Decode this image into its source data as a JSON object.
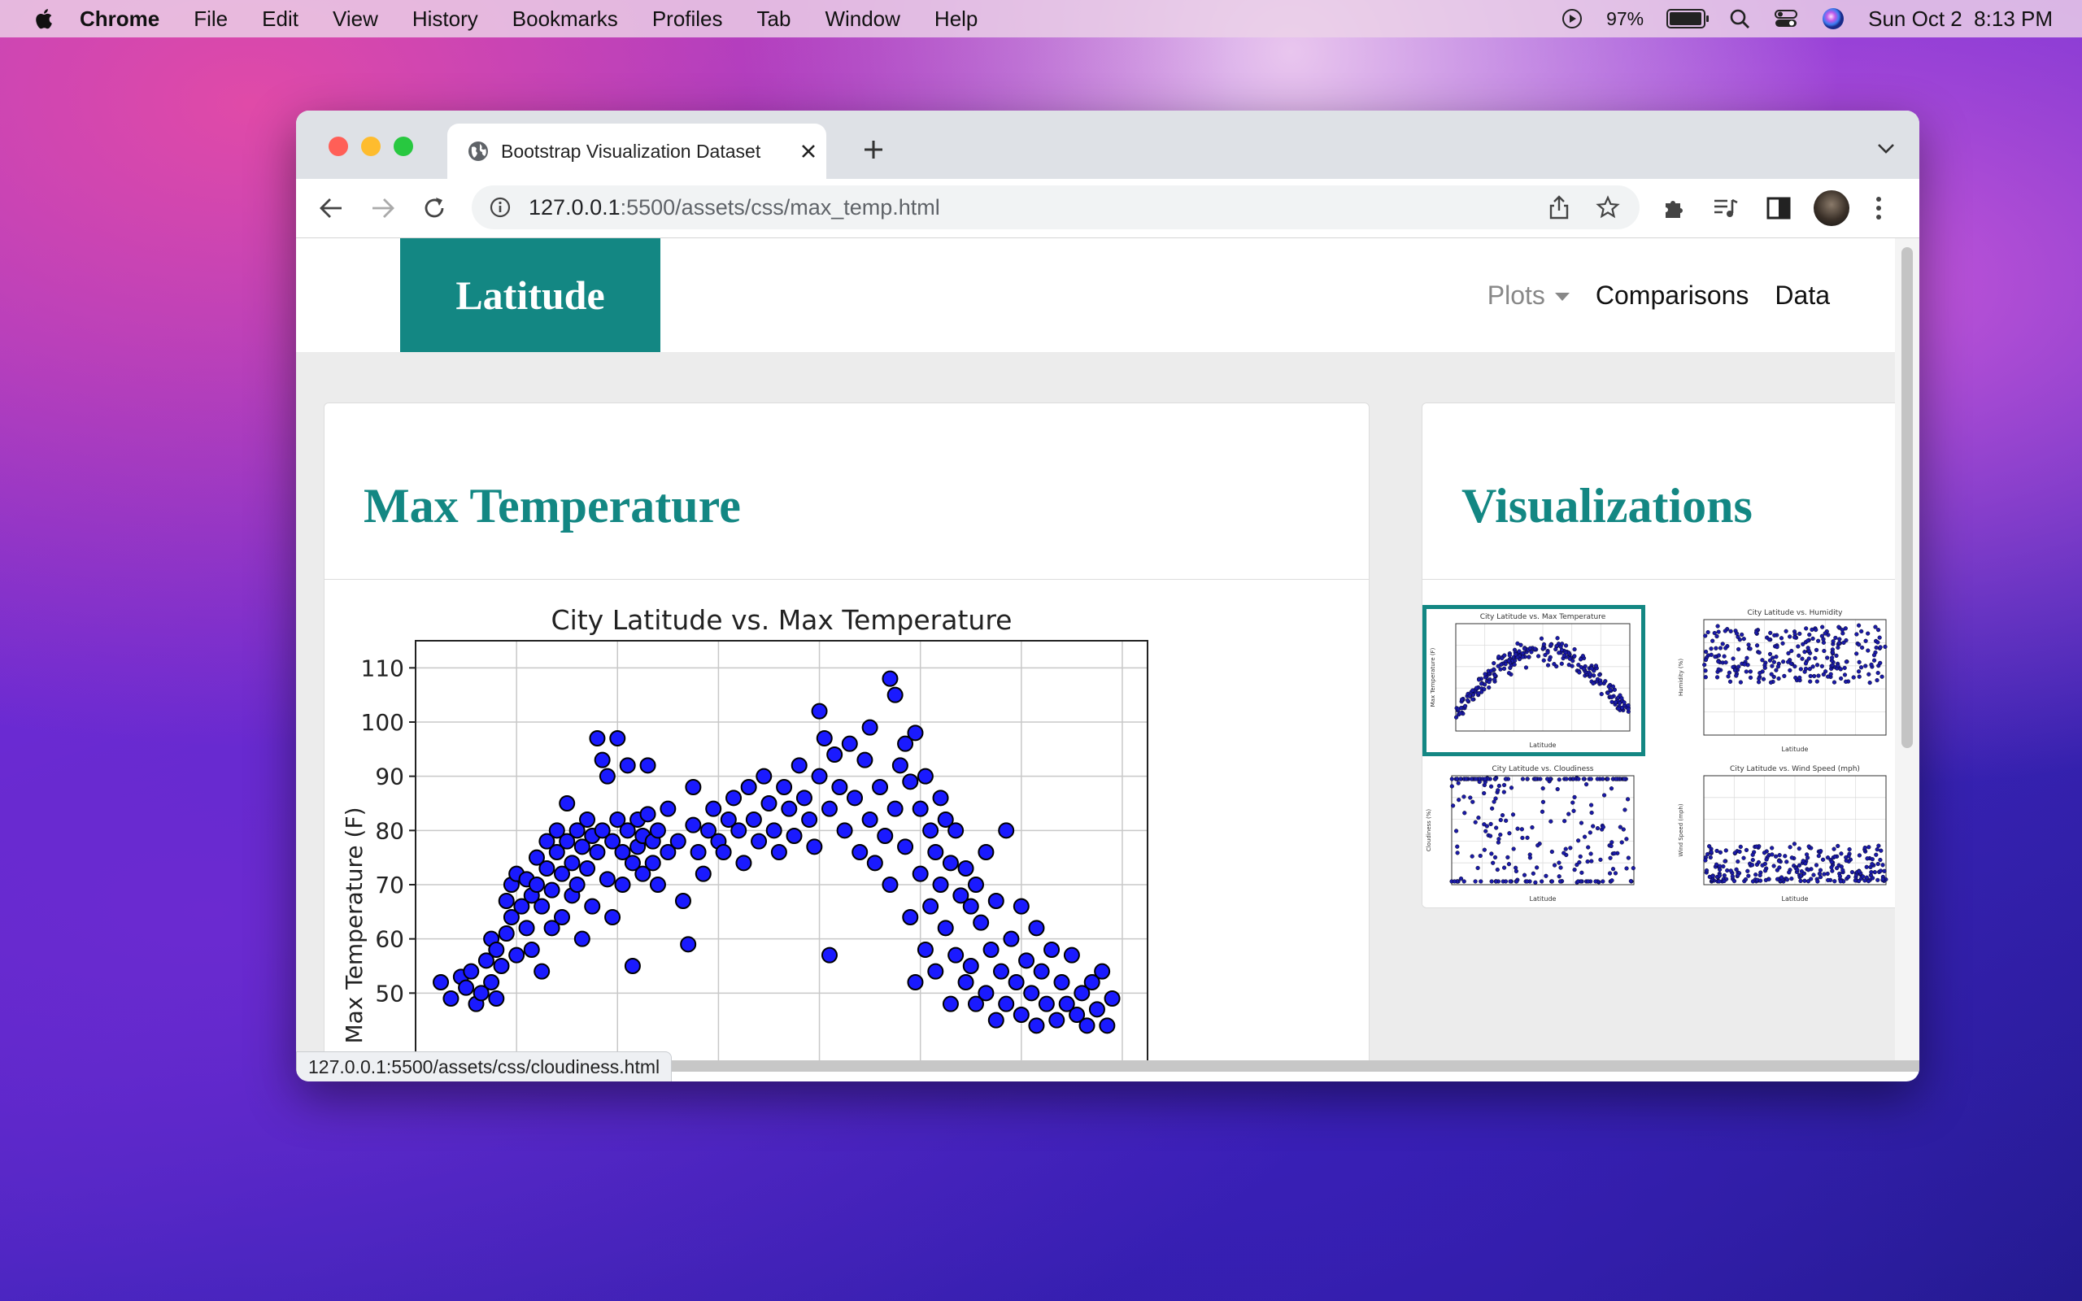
{
  "menubar": {
    "app": "Chrome",
    "items": [
      "File",
      "Edit",
      "View",
      "History",
      "Bookmarks",
      "Profiles",
      "Tab",
      "Window",
      "Help"
    ],
    "battery": "97%",
    "battery_level": 0.97,
    "clock": "Sun Oct 2  8:13 PM"
  },
  "browser": {
    "tab_title": "Bootstrap Visualization Dataset",
    "url_host": "127.0.0.1",
    "url_rest": ":5500/assets/css/max_temp.html",
    "status_url": "127.0.0.1:5500/assets/css/cloudiness.html"
  },
  "site": {
    "brand": "Latitude",
    "nav": {
      "plots": "Plots",
      "comparisons": "Comparisons",
      "data": "Data"
    },
    "main_card_title": "Max Temperature",
    "side_card_title": "Visualizations"
  },
  "thumbnails": [
    {
      "title": "City Latitude vs. Max Temperature",
      "xlabel": "Latitude",
      "ylabel": "Max Temperature (F)",
      "selected": true
    },
    {
      "title": "City Latitude vs. Humidity",
      "xlabel": "Latitude",
      "ylabel": "Humidity (%)",
      "selected": false
    },
    {
      "title": "City Latitude vs. Cloudiness",
      "xlabel": "Latitude",
      "ylabel": "Cloudiness (%)",
      "selected": false
    },
    {
      "title": "City Latitude vs. Wind Speed (mph)",
      "xlabel": "Latitude",
      "ylabel": "Wind Speed (mph)",
      "selected": false
    }
  ],
  "colors": {
    "accent": "#138783",
    "point_fill": "#1a1aff",
    "point_edge": "#000000"
  },
  "chart_data": {
    "type": "scatter",
    "title": "City Latitude vs. Max Temperature",
    "xlabel": "",
    "ylabel": "Max Temperature (F)",
    "xlim": [
      -60,
      85
    ],
    "ylim": [
      10,
      115
    ],
    "yticks": [
      50,
      60,
      70,
      80,
      90,
      100,
      110
    ],
    "grid": true,
    "series": [
      {
        "points": [
          [
            -55,
            52
          ],
          [
            -53,
            49
          ],
          [
            -51,
            53
          ],
          [
            -50,
            51
          ],
          [
            -49,
            54
          ],
          [
            -48,
            48
          ],
          [
            -47,
            50
          ],
          [
            -46,
            56
          ],
          [
            -45,
            60
          ],
          [
            -45,
            52
          ],
          [
            -44,
            58
          ],
          [
            -44,
            49
          ],
          [
            -43,
            55
          ],
          [
            -42,
            67
          ],
          [
            -42,
            61
          ],
          [
            -41,
            70
          ],
          [
            -41,
            64
          ],
          [
            -40,
            72
          ],
          [
            -40,
            57
          ],
          [
            -39,
            66
          ],
          [
            -38,
            71
          ],
          [
            -38,
            62
          ],
          [
            -37,
            68
          ],
          [
            -37,
            58
          ],
          [
            -36,
            75
          ],
          [
            -36,
            70
          ],
          [
            -35,
            66
          ],
          [
            -35,
            54
          ],
          [
            -34,
            78
          ],
          [
            -34,
            73
          ],
          [
            -33,
            69
          ],
          [
            -33,
            62
          ],
          [
            -32,
            80
          ],
          [
            -32,
            76
          ],
          [
            -31,
            72
          ],
          [
            -31,
            64
          ],
          [
            -30,
            85
          ],
          [
            -30,
            78
          ],
          [
            -29,
            74
          ],
          [
            -29,
            68
          ],
          [
            -28,
            80
          ],
          [
            -28,
            70
          ],
          [
            -27,
            77
          ],
          [
            -27,
            60
          ],
          [
            -26,
            82
          ],
          [
            -26,
            73
          ],
          [
            -25,
            79
          ],
          [
            -25,
            66
          ],
          [
            -24,
            97
          ],
          [
            -24,
            76
          ],
          [
            -23,
            93
          ],
          [
            -23,
            80
          ],
          [
            -22,
            90
          ],
          [
            -22,
            71
          ],
          [
            -21,
            78
          ],
          [
            -21,
            64
          ],
          [
            -20,
            97
          ],
          [
            -20,
            82
          ],
          [
            -19,
            76
          ],
          [
            -19,
            70
          ],
          [
            -18,
            92
          ],
          [
            -18,
            80
          ],
          [
            -17,
            74
          ],
          [
            -17,
            55
          ],
          [
            -16,
            82
          ],
          [
            -16,
            77
          ],
          [
            -15,
            79
          ],
          [
            -15,
            72
          ],
          [
            -14,
            92
          ],
          [
            -14,
            83
          ],
          [
            -13,
            78
          ],
          [
            -13,
            74
          ],
          [
            -12,
            80
          ],
          [
            -12,
            70
          ],
          [
            -10,
            84
          ],
          [
            -10,
            76
          ],
          [
            -8,
            78
          ],
          [
            -7,
            67
          ],
          [
            -6,
            59
          ],
          [
            -5,
            88
          ],
          [
            -5,
            81
          ],
          [
            -4,
            76
          ],
          [
            -3,
            72
          ],
          [
            -2,
            80
          ],
          [
            -1,
            84
          ],
          [
            0,
            78
          ],
          [
            1,
            76
          ],
          [
            2,
            82
          ],
          [
            3,
            86
          ],
          [
            4,
            80
          ],
          [
            5,
            74
          ],
          [
            6,
            88
          ],
          [
            7,
            82
          ],
          [
            8,
            78
          ],
          [
            9,
            90
          ],
          [
            10,
            85
          ],
          [
            11,
            80
          ],
          [
            12,
            76
          ],
          [
            13,
            88
          ],
          [
            14,
            84
          ],
          [
            15,
            79
          ],
          [
            16,
            92
          ],
          [
            17,
            86
          ],
          [
            18,
            82
          ],
          [
            19,
            77
          ],
          [
            20,
            102
          ],
          [
            20,
            90
          ],
          [
            21,
            97
          ],
          [
            22,
            84
          ],
          [
            22,
            57
          ],
          [
            23,
            94
          ],
          [
            24,
            88
          ],
          [
            25,
            80
          ],
          [
            26,
            96
          ],
          [
            27,
            86
          ],
          [
            28,
            76
          ],
          [
            29,
            93
          ],
          [
            30,
            99
          ],
          [
            30,
            82
          ],
          [
            31,
            74
          ],
          [
            32,
            88
          ],
          [
            33,
            79
          ],
          [
            34,
            108
          ],
          [
            34,
            70
          ],
          [
            35,
            105
          ],
          [
            35,
            84
          ],
          [
            36,
            92
          ],
          [
            37,
            96
          ],
          [
            37,
            77
          ],
          [
            38,
            89
          ],
          [
            38,
            64
          ],
          [
            39,
            98
          ],
          [
            39,
            52
          ],
          [
            40,
            84
          ],
          [
            40,
            72
          ],
          [
            41,
            90
          ],
          [
            41,
            58
          ],
          [
            42,
            80
          ],
          [
            42,
            66
          ],
          [
            43,
            76
          ],
          [
            43,
            54
          ],
          [
            44,
            86
          ],
          [
            44,
            70
          ],
          [
            45,
            82
          ],
          [
            45,
            62
          ],
          [
            46,
            74
          ],
          [
            46,
            48
          ],
          [
            47,
            80
          ],
          [
            47,
            57
          ],
          [
            48,
            68
          ],
          [
            49,
            73
          ],
          [
            49,
            52
          ],
          [
            50,
            66
          ],
          [
            50,
            55
          ],
          [
            51,
            70
          ],
          [
            51,
            48
          ],
          [
            52,
            63
          ],
          [
            53,
            76
          ],
          [
            53,
            50
          ],
          [
            54,
            58
          ],
          [
            55,
            67
          ],
          [
            55,
            45
          ],
          [
            56,
            54
          ],
          [
            57,
            80
          ],
          [
            57,
            48
          ],
          [
            58,
            60
          ],
          [
            59,
            52
          ],
          [
            60,
            66
          ],
          [
            60,
            46
          ],
          [
            61,
            56
          ],
          [
            62,
            50
          ],
          [
            63,
            62
          ],
          [
            63,
            44
          ],
          [
            64,
            54
          ],
          [
            65,
            48
          ],
          [
            66,
            58
          ],
          [
            67,
            45
          ],
          [
            68,
            52
          ],
          [
            69,
            48
          ],
          [
            70,
            57
          ],
          [
            71,
            46
          ],
          [
            72,
            50
          ],
          [
            73,
            44
          ],
          [
            74,
            52
          ],
          [
            75,
            47
          ],
          [
            76,
            54
          ],
          [
            77,
            44
          ],
          [
            78,
            49
          ]
        ]
      }
    ]
  }
}
